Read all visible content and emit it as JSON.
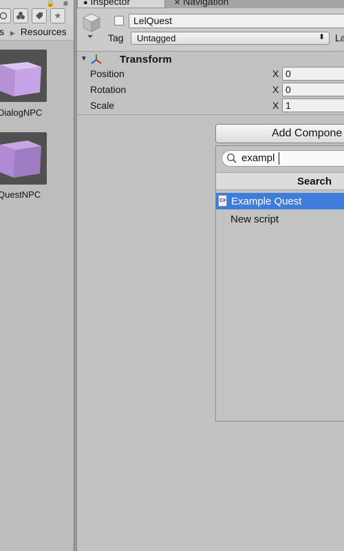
{
  "project": {
    "breadcrumb_parent": "s",
    "breadcrumb_current": "Resources",
    "assets": [
      {
        "label": "DialogNPC",
        "color": "#c7a3e8"
      },
      {
        "label": "QuestNPC",
        "color": "#b18ad6"
      }
    ]
  },
  "tabs": {
    "inspector": "Inspector",
    "navigation": "Navigation"
  },
  "object": {
    "name": "LelQuest",
    "active": false,
    "tag_label": "Tag",
    "tag_value": "Untagged",
    "layer_label": "La"
  },
  "transform": {
    "title": "Transform",
    "rows": [
      {
        "label": "Position",
        "axis": "X",
        "value": "0"
      },
      {
        "label": "Rotation",
        "axis": "X",
        "value": "0"
      },
      {
        "label": "Scale",
        "axis": "X",
        "value": "1"
      }
    ]
  },
  "add_component": {
    "button_label": "Add Compone",
    "search_value": "exampl",
    "header": "Search",
    "results": [
      {
        "label": "Example Quest",
        "selected": true,
        "icon": "cs-script-icon"
      },
      {
        "label": "New script",
        "selected": false
      }
    ]
  },
  "colors": {
    "selection": "#3e7ddc",
    "panel_bg": "#c2c2c2",
    "cube_color": "#c7a3e8"
  }
}
